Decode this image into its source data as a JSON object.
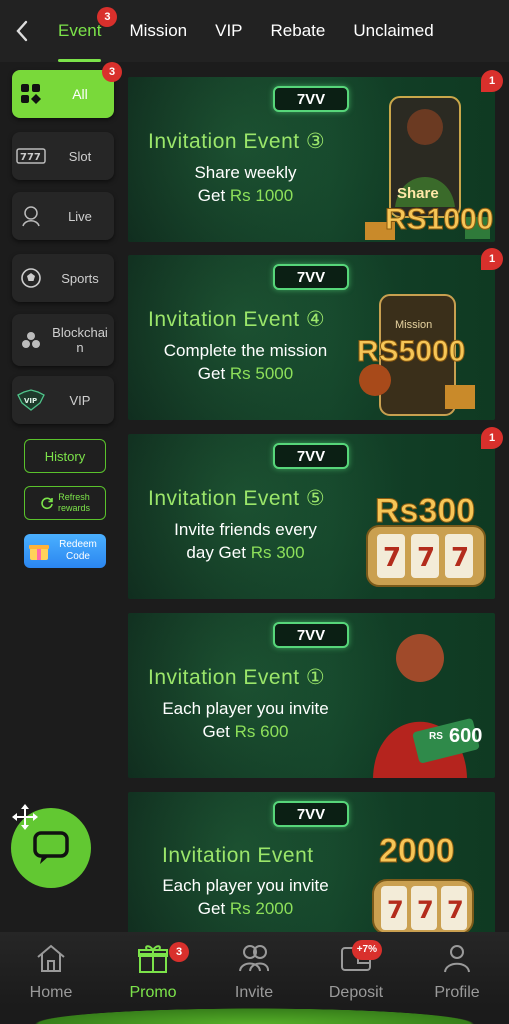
{
  "topbar": {
    "tabs": [
      {
        "label": "Event",
        "badge": "3"
      },
      {
        "label": "Mission"
      },
      {
        "label": "VIP"
      },
      {
        "label": "Rebate"
      },
      {
        "label": "Unclaimed"
      }
    ]
  },
  "sidebar": {
    "categories": [
      {
        "label": "All",
        "badge": "3"
      },
      {
        "label": "Slot"
      },
      {
        "label": "Live"
      },
      {
        "label": "Sports"
      },
      {
        "label": "Blockchai\nn"
      },
      {
        "label": "VIP"
      }
    ],
    "history_label": "History",
    "refresh_label": "Refresh\nrewards",
    "redeem_label": "Redeem\nCode"
  },
  "banners": [
    {
      "brand": "7VV",
      "title": "Invitation Event ③",
      "line1": "Share weekly",
      "line2_prefix": "Get ",
      "line2_amount": "Rs 1000",
      "art_text": "RS1000",
      "art_sub": "Share",
      "badge": "1"
    },
    {
      "brand": "7VV",
      "title": "Invitation Event ④",
      "line1": "Complete the mission",
      "line2_prefix": "Get ",
      "line2_amount": "Rs 5000",
      "art_text": "RS5000",
      "art_sub": "Mission",
      "badge": "1"
    },
    {
      "brand": "7VV",
      "title": "Invitation Event ⑤",
      "line1": "Invite friends every",
      "line2_prefix": "day Get ",
      "line2_amount": "Rs 300",
      "art_text": "Rs300",
      "art_sub": "",
      "badge": "1"
    },
    {
      "brand": "7VV",
      "title": "Invitation Event ①",
      "line1": "Each player you invite",
      "line2_prefix": "Get ",
      "line2_amount": "Rs 600",
      "art_text": "600",
      "art_sub": "RS",
      "badge": ""
    },
    {
      "brand": "7VV",
      "title": "Invitation Event",
      "line1": "Each player you invite",
      "line2_prefix": "Get ",
      "line2_amount": "Rs 2000",
      "art_text": "2000",
      "art_sub": "",
      "badge": ""
    }
  ],
  "bottom_nav": [
    {
      "label": "Home"
    },
    {
      "label": "Promo",
      "badge": "3"
    },
    {
      "label": "Invite"
    },
    {
      "label": "Deposit",
      "badge": "+7%"
    },
    {
      "label": "Profile"
    }
  ],
  "colors": {
    "accent": "#7ce34a",
    "badge": "#d9302c",
    "banner_bg": "#134028"
  }
}
